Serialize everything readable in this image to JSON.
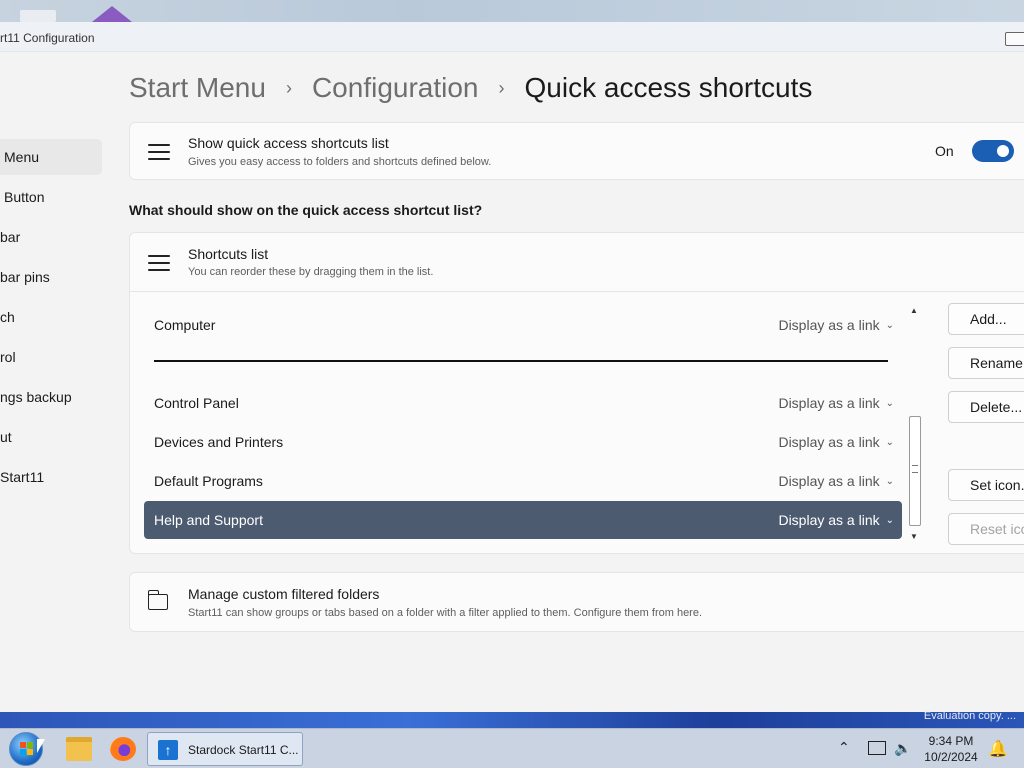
{
  "window": {
    "title": "rt11 Configuration"
  },
  "nav": {
    "items": [
      {
        "label": "Menu",
        "active": true
      },
      {
        "label": "Button",
        "active": false
      },
      {
        "label": "bar",
        "active": false
      },
      {
        "label": "bar pins",
        "active": false
      },
      {
        "label": "ch",
        "active": false
      },
      {
        "label": "rol",
        "active": false
      },
      {
        "label": "ngs backup",
        "active": false
      },
      {
        "label": "ut",
        "active": false
      },
      {
        "label": "Start11",
        "active": false
      }
    ]
  },
  "breadcrumb": {
    "parts": [
      "Start Menu",
      "Configuration"
    ],
    "current": "Quick access shortcuts",
    "separator": "›"
  },
  "show_card": {
    "icon": "hamburger-icon",
    "title": "Show quick access shortcuts list",
    "subtitle": "Gives you easy access to folders and shortcuts defined below.",
    "toggle_label": "On",
    "toggle_on": true
  },
  "question": "What should show on the quick access shortcut list?",
  "shortcuts_card": {
    "icon": "hamburger-icon",
    "title": "Shortcuts list",
    "subtitle": "You can reorder these by dragging them in the list.",
    "rows": [
      {
        "name": "Computer",
        "display": "Display as a link",
        "selected": false
      },
      {
        "name": "Control Panel",
        "display": "Display as a link",
        "selected": false
      },
      {
        "name": "Devices and Printers",
        "display": "Display as a link",
        "selected": false
      },
      {
        "name": "Default Programs",
        "display": "Display as a link",
        "selected": false
      },
      {
        "name": "Help and Support",
        "display": "Display as a link",
        "selected": true
      }
    ],
    "buttons": {
      "add": "Add...",
      "rename": "Rename...",
      "delete": "Delete...",
      "set_icon": "Set icon...",
      "reset_icon": "Reset icon"
    }
  },
  "folders_card": {
    "icon": "folder-icon",
    "title": "Manage custom filtered folders",
    "subtitle": "Start11 can show groups or tabs based on a folder with a filter applied to them.  Configure them from here."
  },
  "desktop": {
    "eval_text": "Evaluation copy. ..."
  },
  "taskbar": {
    "app_label": "Stardock Start11 C...",
    "time": "9:34 PM",
    "date": "10/2/2024"
  }
}
